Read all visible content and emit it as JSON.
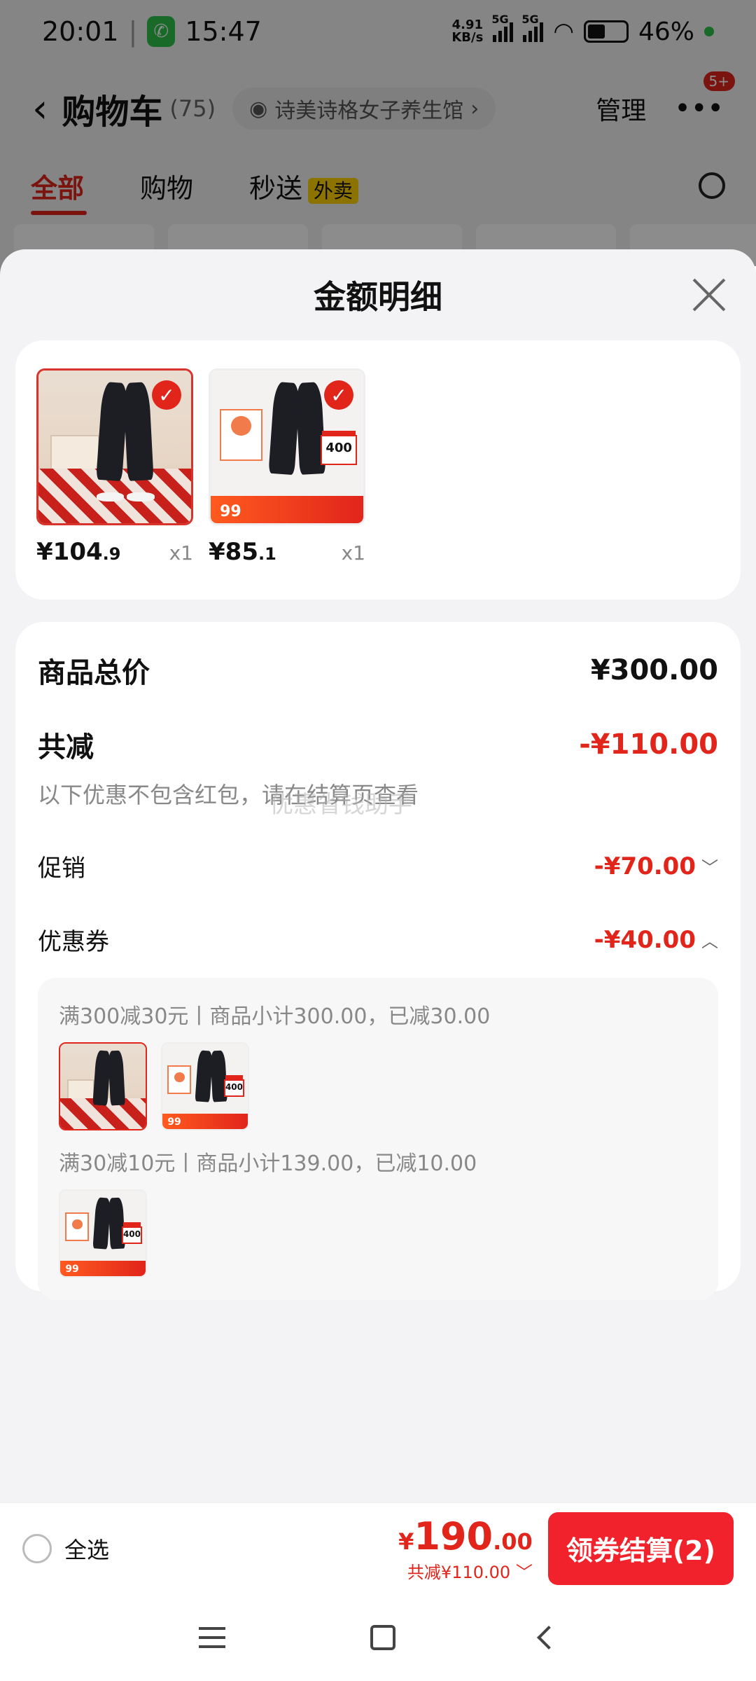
{
  "status_bar": {
    "time": "20:01",
    "call_time": "15:47",
    "net_speed_value": "4.91",
    "net_speed_unit": "KB/s",
    "network_label": "5G",
    "battery_percent": "46%"
  },
  "cart_header": {
    "title": "购物车",
    "count": "(75)",
    "shop_name": "诗美诗格女子养生馆",
    "manage_label": "管理",
    "more_badge": "5+"
  },
  "tabs": {
    "all": "全部",
    "shopping": "购物",
    "express": "秒送",
    "express_tag": "外卖"
  },
  "sheet": {
    "title": "金额明细",
    "items": [
      {
        "price_int": "¥104",
        "price_dec": ".9",
        "qty": "x1",
        "badge_price": ""
      },
      {
        "price_int": "¥85",
        "price_dec": ".1",
        "qty": "x1",
        "badge_price": "99",
        "box_text": "400"
      }
    ],
    "summary": {
      "total_label": "商品总价",
      "total_value": "¥300.00",
      "reduce_label": "共减",
      "reduce_value": "-¥110.00",
      "note": "以下优惠不包含红包，请在结算页查看",
      "watermark": "优惠省钱助手",
      "promo_label": "促销",
      "promo_value": "-¥70.00",
      "coupon_label": "优惠券",
      "coupon_value": "-¥40.00"
    },
    "coupon_details": [
      {
        "text": "满300减30元丨商品小计300.00，已减30.00"
      },
      {
        "text": "满30减10元丨商品小计139.00，已减10.00"
      }
    ]
  },
  "checkout": {
    "select_all_label": "全选",
    "currency": "¥",
    "total_int": "190",
    "total_dec": ".00",
    "saved": "共减¥110.00",
    "pay_label": "领券结算(2)"
  },
  "colors": {
    "accent": "#e1251b",
    "pay_button": "#f1222b"
  }
}
